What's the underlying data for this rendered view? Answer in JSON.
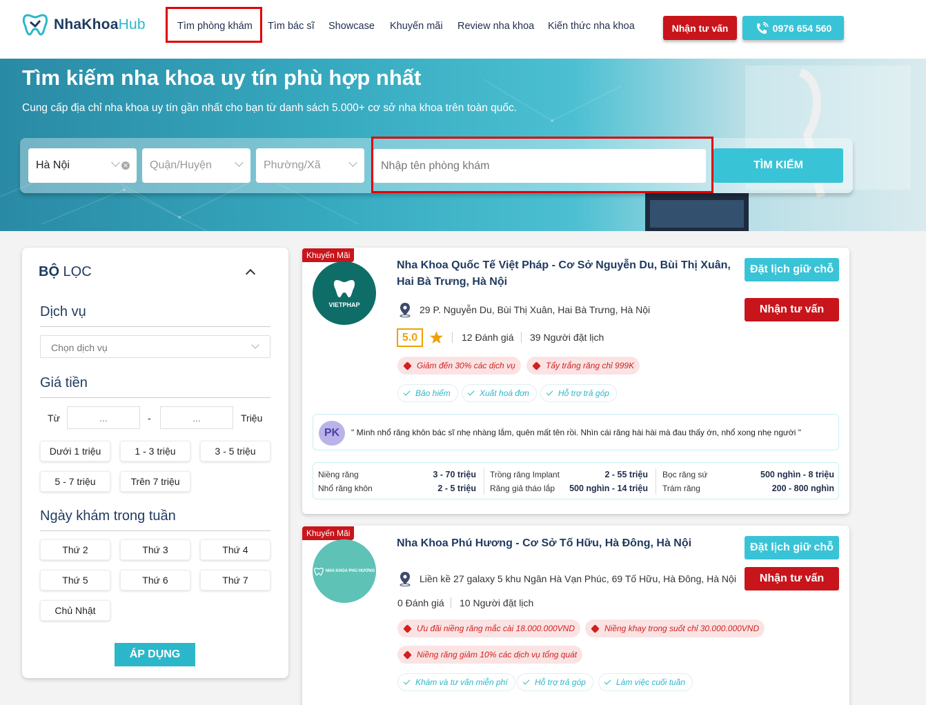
{
  "header": {
    "logo_main": "NhaKhoa",
    "logo_hub": "Hub",
    "nav": [
      "Tìm phòng khám",
      "Tìm bác sĩ",
      "Showcase",
      "Khuyến mãi",
      "Review nha khoa",
      "Kiến thức nha khoa"
    ],
    "consult_button": "Nhận tư vấn",
    "phone_button": "0976 654 560"
  },
  "hero": {
    "title": "Tìm kiếm nha khoa uy tín phù hợp nhất",
    "subtitle": "Cung cấp địa chỉ nha khoa uy tín gần nhất cho bạn từ danh sách 5.000+ cơ sở nha khoa trên toàn quốc.",
    "city_value": "Hà Nội",
    "district_placeholder": "Quận/Huyện",
    "ward_placeholder": "Phường/Xã",
    "name_placeholder": "Nhập tên phòng khám",
    "search_button": "TÌM KIẾM"
  },
  "filter": {
    "title_bold": "BỘ",
    "title_rest": " LỌC",
    "service_heading": "Dịch vụ",
    "service_placeholder": "Chọn dịch vụ",
    "price_heading": "Giá tiền",
    "from_label": "Từ",
    "from_value": "...",
    "dash": "-",
    "to_value": "...",
    "unit_label": "Triệu",
    "price_ranges": [
      "Dưới 1 triệu",
      "1 - 3 triệu",
      "3 - 5 triệu",
      "5 - 7 triệu",
      "Trên 7 triệu"
    ],
    "days_heading": "Ngày khám trong tuần",
    "days": [
      "Thứ 2",
      "Thứ 3",
      "Thứ 4",
      "Thứ 5",
      "Thứ 6",
      "Thứ 7",
      "Chủ Nhật"
    ],
    "apply_button": "ÁP DỤNG"
  },
  "clinics": [
    {
      "badge": "Khuyến Mãi",
      "logo_text": "VIETPHAP",
      "name": "Nha Khoa Quốc Tế Việt Pháp - Cơ Sở Nguyễn Du, Bùi Thị Xuân, Hai Bà Trưng, Hà Nội",
      "address": "29 P. Nguyễn Du, Bùi Thị Xuân, Hai Bà Trưng, Hà Nội",
      "rating": "5.0",
      "reviews": "12 Đánh giá",
      "bookings": "39 Người đặt lịch",
      "promos": [
        "Giảm đến 30% các dịch vụ",
        "Tẩy trắng răng chỉ 999K"
      ],
      "features": [
        "Bảo hiểm",
        "Xuất hoá đơn",
        "Hỗ trợ trả góp"
      ],
      "review_initials": "PK",
      "review_text": "\" Mình nhổ răng khôn bác sĩ nhẹ nhàng lắm, quên mất tên rồi. Nhìn cái răng hài hài mà đau thấy ớn, nhổ xong nhẹ người \"",
      "prices": [
        {
          "name": "Niềng răng",
          "value": "3 - 70 triệu"
        },
        {
          "name": "Nhổ răng khôn",
          "value": "2 - 5 triệu"
        },
        {
          "name": "Trồng răng Implant",
          "value": "2 - 55 triệu"
        },
        {
          "name": "Răng giả tháo lắp",
          "value": "500 nghìn - 14 triệu"
        },
        {
          "name": "Bọc răng sứ",
          "value": "500 nghìn - 8 triệu"
        },
        {
          "name": "Trám răng",
          "value": "200 - 800 nghìn"
        }
      ],
      "book_button": "Đặt lịch giữ chỗ",
      "consult_button": "Nhận tư vấn"
    },
    {
      "badge": "Khuyến Mãi",
      "logo_text": "NHA KHOA PHÚ HƯƠNG",
      "name": "Nha Khoa Phú Hương - Cơ Sở Tố Hữu, Hà Đông, Hà Nội",
      "address": "Liền kề 27 galaxy 5 khu Ngân Hà Vạn Phúc, 69 Tố Hữu, Hà Đông, Hà Nội",
      "reviews": "0 Đánh giá",
      "bookings": "10 Người đặt lịch",
      "promos": [
        "Ưu đãi niềng răng mắc cài 18.000.000VND",
        "Niềng khay trong suốt chỉ 30.000.000VND",
        "Niềng răng giảm 10% các dịch vụ tổng quát"
      ],
      "features": [
        "Khám và tư vấn miễn phí",
        "Hỗ trợ trả góp",
        "Làm việc cuối tuần"
      ],
      "book_button": "Đặt lịch giữ chỗ",
      "consult_button": "Nhận tư vấn"
    }
  ],
  "colors": {
    "brand_teal": "#39c3d6",
    "brand_red": "#c8151b",
    "navy": "#1f3a5f"
  }
}
